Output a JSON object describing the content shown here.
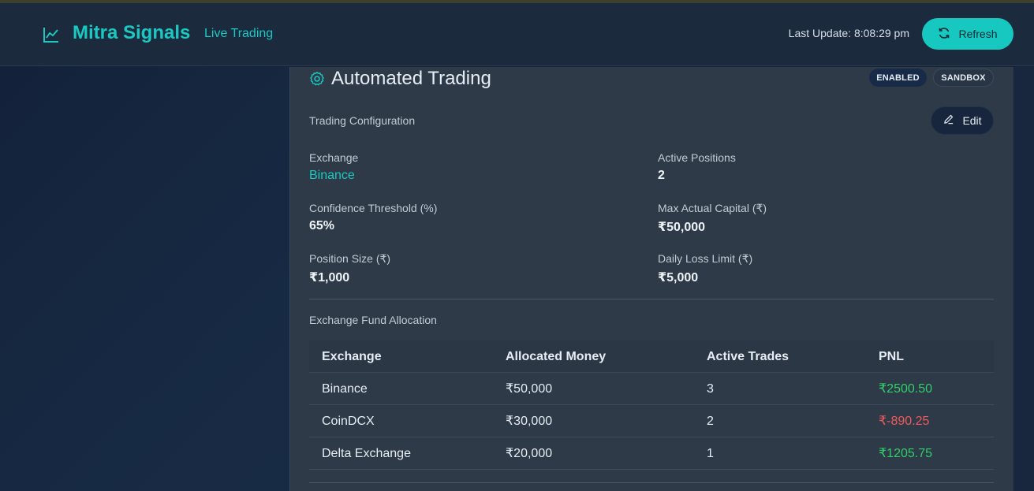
{
  "header": {
    "title": "Mitra Signals",
    "subtitle": "Live Trading",
    "last_update": "Last Update: 8:08:29 pm",
    "refresh_label": "Refresh"
  },
  "panel": {
    "title": "Automated Trading",
    "badges": [
      "ENABLED",
      "SANDBOX"
    ],
    "config_label": "Trading Configuration",
    "edit_label": "Edit",
    "fields": {
      "exchange": {
        "label": "Exchange",
        "value": "Binance"
      },
      "active_positions": {
        "label": "Active Positions",
        "value": "2"
      },
      "confidence": {
        "label": "Confidence Threshold (%)",
        "value": "65%"
      },
      "max_capital": {
        "label": "Max Actual Capital (₹)",
        "value": "₹50,000"
      },
      "position_size": {
        "label": "Position Size (₹)",
        "value": "₹1,000"
      },
      "daily_loss": {
        "label": "Daily Loss Limit (₹)",
        "value": "₹5,000"
      }
    },
    "fund_label": "Exchange Fund Allocation",
    "table": {
      "headers": [
        "Exchange",
        "Allocated Money",
        "Active Trades",
        "PNL"
      ],
      "rows": [
        [
          "Binance",
          "₹50,000",
          "3",
          "₹2500.50"
        ],
        [
          "CoinDCX",
          "₹30,000",
          "2",
          "₹-890.25"
        ],
        [
          "Delta Exchange",
          "₹20,000",
          "1",
          "₹1205.75"
        ]
      ]
    }
  },
  "colors": {
    "accent": "#19c9c2",
    "positive": "#2fcf6a",
    "negative": "#ef5a5a"
  },
  "icons": [
    "chart-line-icon",
    "refresh-icon",
    "gear-icon",
    "pencil-icon"
  ]
}
